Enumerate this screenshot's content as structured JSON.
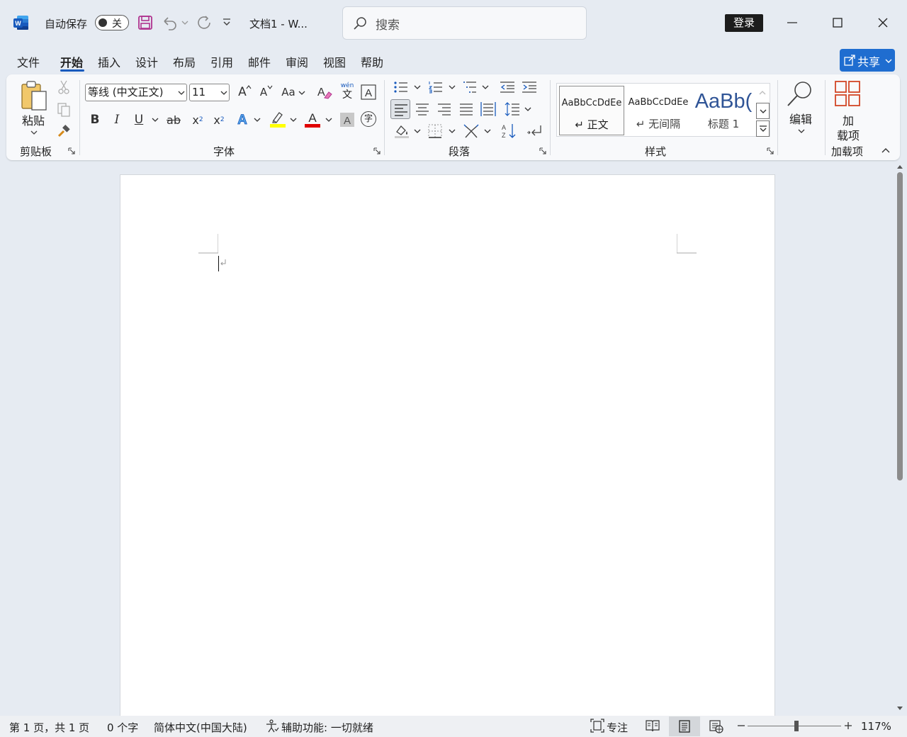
{
  "titlebar": {
    "autosave_label": "自动保存",
    "autosave_state": "关",
    "doc_title": "文档1  -  W...",
    "search_placeholder": "搜索",
    "login_label": "登录"
  },
  "menu": {
    "tabs": [
      {
        "label": "文件"
      },
      {
        "label": "开始"
      },
      {
        "label": "插入"
      },
      {
        "label": "设计"
      },
      {
        "label": "布局"
      },
      {
        "label": "引用"
      },
      {
        "label": "邮件"
      },
      {
        "label": "审阅"
      },
      {
        "label": "视图"
      },
      {
        "label": "帮助"
      }
    ],
    "active_tab": "开始",
    "share_label": "共享"
  },
  "ribbon": {
    "clipboard": {
      "paste_label": "粘贴",
      "group_label": "剪贴板"
    },
    "font": {
      "font_name": "等线 (中文正文)",
      "font_size": "11",
      "grow_label": "A",
      "shrink_label": "A",
      "case_label": "Aa",
      "phonetic_top": "wén",
      "phonetic_bottom": "文",
      "bold_label": "B",
      "italic_label": "I",
      "underline_label": "U",
      "strike_label": "ab",
      "subscript_label": "x",
      "superscript_label": "x",
      "enclose_label": "字",
      "group_label": "字体"
    },
    "paragraph": {
      "group_label": "段落"
    },
    "styles": {
      "items": [
        {
          "preview": "AaBbCcDdEe",
          "name": "↵ 正文"
        },
        {
          "preview": "AaBbCcDdEe",
          "name": "↵ 无间隔"
        },
        {
          "preview": "AaBb(",
          "name": "标题 1"
        }
      ],
      "group_label": "样式"
    },
    "editing": {
      "label": "编辑"
    },
    "addins": {
      "label_line1": "加",
      "label_line2": "载项",
      "group_label": "加载项"
    }
  },
  "statusbar": {
    "page_info": "第 1 页，共 1 页",
    "word_count": "0 个字",
    "language": "简体中文(中国大陆)",
    "accessibility": "辅助功能: 一切就绪",
    "focus_label": "专注",
    "zoom_level": "117%"
  },
  "colors": {
    "accent": "#185abd",
    "share_button": "#1f6dd0",
    "highlight": "#ffff00",
    "font_color": "#e00000"
  }
}
